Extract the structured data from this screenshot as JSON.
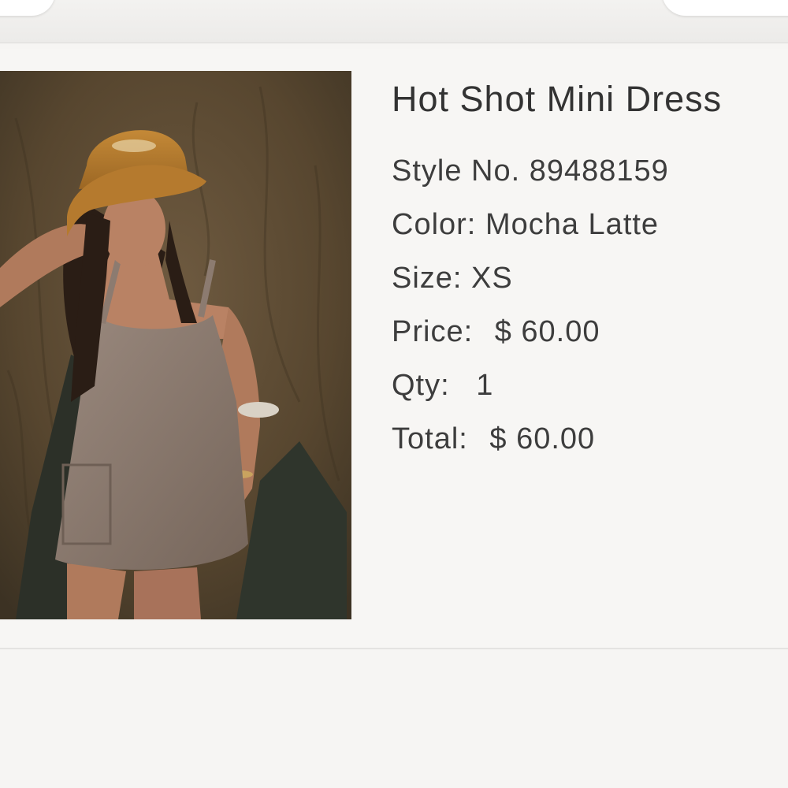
{
  "product": {
    "title": "Hot Shot Mini Dress",
    "style_label": "Style No.",
    "style_value": "89488159",
    "color_label": "Color:",
    "color_value": "Mocha Latte",
    "size_label": "Size:",
    "size_value": "XS",
    "price_label": "Price:",
    "price_value": "$ 60.00",
    "qty_label": "Qty:",
    "qty_value": "1",
    "total_label": "Total:",
    "total_value": "$ 60.00"
  },
  "image": {
    "icon": "product-photo",
    "colors": {
      "backdrop": "#5b4a34",
      "hat": "#b57a2e",
      "dress": "#8c7b70",
      "skin": "#b98264"
    }
  },
  "theme": {
    "background": "#f6f5f3",
    "text": "#3a3a3a"
  }
}
